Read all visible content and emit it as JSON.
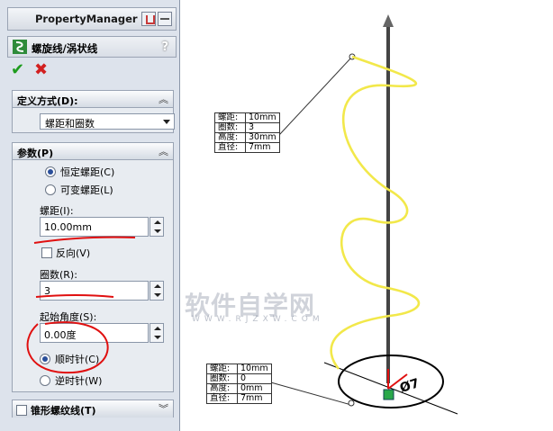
{
  "panel": {
    "title": "PropertyManager",
    "feature_title": "螺旋线/涡状线",
    "help": "?",
    "ok_symbol": "✔",
    "cancel_symbol": "✖"
  },
  "define_by": {
    "header": "定义方式(D):",
    "selected": "螺距和圈数"
  },
  "params": {
    "header": "参数(P)",
    "option_constant": "恒定螺距(C)",
    "option_variable": "可变螺距(L)",
    "pitch_label": "螺距(I):",
    "pitch_value": "10.00mm",
    "reverse_label": "反向(V)",
    "revolutions_label": "圈数(R):",
    "revolutions_value": "3",
    "start_angle_label": "起始角度(S):",
    "start_angle_value": "0.00度",
    "option_cw": "顺时针(C)",
    "option_ccw": "逆时针(W)"
  },
  "taper": {
    "header": "锥形螺纹线(T)"
  },
  "callout_top": {
    "rows": [
      {
        "k": "螺距:",
        "v": "10mm"
      },
      {
        "k": "圈数:",
        "v": "3"
      },
      {
        "k": "高度:",
        "v": "30mm"
      },
      {
        "k": "直径:",
        "v": "7mm"
      }
    ]
  },
  "callout_bottom": {
    "rows": [
      {
        "k": "螺距:",
        "v": "10mm"
      },
      {
        "k": "圈数:",
        "v": "0"
      },
      {
        "k": "高度:",
        "v": "0mm"
      },
      {
        "k": "直径:",
        "v": "7mm"
      }
    ]
  },
  "dimension_label": "Ø7",
  "watermark": {
    "main": "软件自学网",
    "sub": "WWW.RJZXW.COM"
  },
  "colors": {
    "helix": "#f2e84a",
    "annotation_red": "#e01010",
    "panel_bg": "#dde3ec"
  }
}
